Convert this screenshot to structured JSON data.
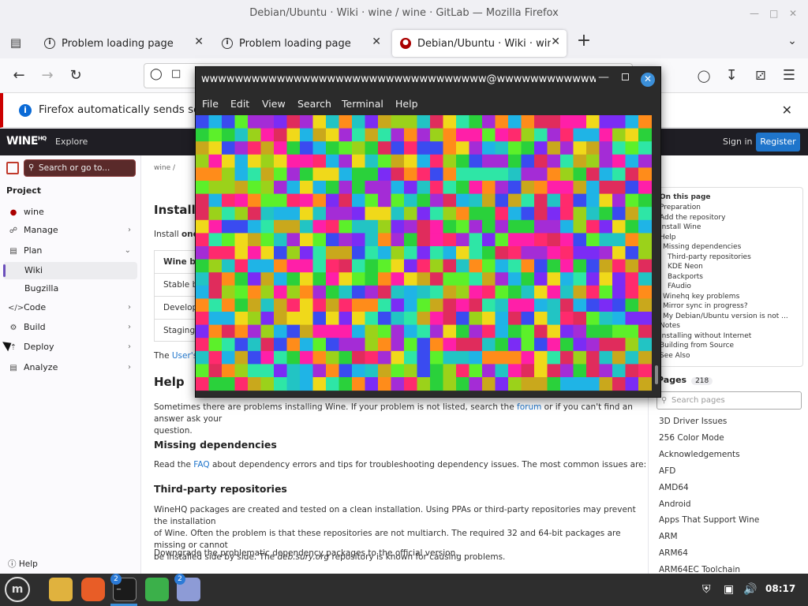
{
  "window": {
    "title": "Debian/Ubuntu · Wiki · wine / wine · GitLab — Mozilla Firefox"
  },
  "tabs": [
    {
      "label": "Problem loading page"
    },
    {
      "label": "Problem loading page"
    },
    {
      "label": "Debian/Ubuntu · Wiki · wine"
    }
  ],
  "notification": {
    "text": "Firefox automatically sends some"
  },
  "gitlab": {
    "logo": "WINE",
    "logo_sup": "HQ",
    "explore": "Explore",
    "signin": "Sign in",
    "register": "Register"
  },
  "sidebar": {
    "search_placeholder": "Search or go to...",
    "project_heading": "Project",
    "items": [
      {
        "label": "wine",
        "icon": "wine-glass-icon"
      },
      {
        "label": "Manage",
        "icon": "manage-icon"
      },
      {
        "label": "Plan",
        "icon": "plan-icon"
      },
      {
        "label": "Wiki"
      },
      {
        "label": "Bugzilla"
      },
      {
        "label": "Code",
        "icon": "code-icon"
      },
      {
        "label": "Build",
        "icon": "build-icon"
      },
      {
        "label": "Deploy",
        "icon": "deploy-icon"
      },
      {
        "label": "Analyze",
        "icon": "analyze-icon"
      }
    ],
    "help": "Help"
  },
  "main": {
    "breadcrumb": "wine  /",
    "install_heading": "Install W",
    "install_text_pre": "Install ",
    "install_text_bold": "one",
    "table_header": "Wine bra",
    "table_rows": [
      "Stable b",
      "Develop",
      "Staging b"
    ],
    "users_pre": "The ",
    "users_link": "User's",
    "help_heading": "Help",
    "help_text_1": "Sometimes there are problems installing Wine. If your problem is not listed, search the ",
    "help_link": "forum",
    "help_text_2": " or if you can't find an answer ask your",
    "help_text_3": "question.",
    "missing_heading": "Missing dependencies",
    "missing_pre": "Read the ",
    "missing_link": "FAQ",
    "missing_post": " about dependency errors and tips for troubleshooting dependency issues. The most common issues are:",
    "thirdparty_heading": "Third-party repositories",
    "thirdparty_l1": "WineHQ packages are created and tested on a clean installation. Using PPAs or third-party repositories may prevent the installation",
    "thirdparty_l2": "of Wine. Often the problem is that these repositories are not multiarch. The required 32 and 64-bit packages are missing or cannot",
    "thirdparty_l3_pre": "be installed side by side. The ",
    "thirdparty_l3_em": "deb.sury.org",
    "thirdparty_l3_post": " repository is known for causing problems.",
    "downgrade": "Downgrade the problematic dependency packages to the official version."
  },
  "toc": {
    "items": [
      "On this page",
      "Preparation",
      "Add the repository",
      "Install Wine",
      "Help",
      "Missing dependencies",
      "Third-party repositories",
      "KDE Neon",
      "Backports",
      "FAudio",
      "Winehq key problems",
      "Mirror sync in progress?",
      "My Debian/Ubuntu version is not ...",
      "Notes",
      "Installing without Internet",
      "Building from Source",
      "See Also"
    ]
  },
  "pages": {
    "heading": "Pages",
    "count": "218",
    "search_placeholder": "Search pages",
    "items": [
      "3D Driver Issues",
      "256 Color Mode",
      "Acknowledgements",
      "AFD",
      "AMD64",
      "Android",
      "Apps That Support Wine",
      "ARM",
      "ARM64",
      "ARM64EC Toolchain"
    ]
  },
  "terminal": {
    "title": "wwwwwwwwwwwwwwwwwwwwwwwwwwwwwwwwww@wwwwwwwwwwww...",
    "menu": [
      "File",
      "Edit",
      "View",
      "Search",
      "Terminal",
      "Help"
    ],
    "palette": [
      "#ff2a6d",
      "#2ee6a6",
      "#7b2cf5",
      "#9bd21a",
      "#1fb4e6",
      "#ff8c1a",
      "#ff1fa8",
      "#2ad13b",
      "#c9a81c",
      "#3a4bf0",
      "#a42cd6",
      "#22c4c4",
      "#f0d91a",
      "#e02c5c",
      "#5cf02a"
    ],
    "cols": 35,
    "rows": 21
  },
  "taskbar": {
    "clock": "08:17",
    "badge1": "2",
    "badge2": "2",
    "apps": [
      "menu-icon",
      "files-icon",
      "firefox-icon",
      "terminal-icon",
      "shield-icon",
      "text-editor-icon"
    ]
  }
}
